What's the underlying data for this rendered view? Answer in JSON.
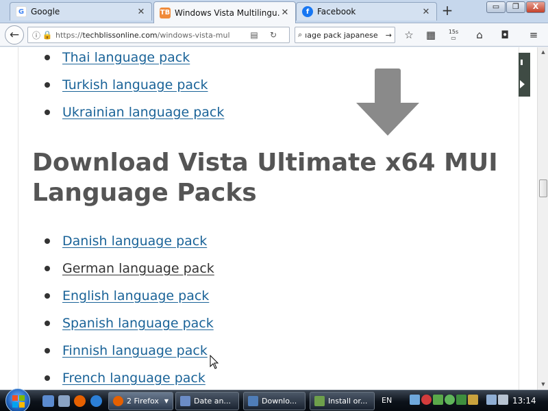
{
  "browser": {
    "tabs": [
      {
        "title": "Google",
        "favicon": "G",
        "favicon_color": "#4285f4",
        "active": false
      },
      {
        "title": "Windows Vista Multilingu…",
        "favicon": "TB",
        "favicon_color": "#f08b3a",
        "active": true
      },
      {
        "title": "Facebook",
        "favicon": "f",
        "favicon_color": "#1877f2",
        "active": false
      }
    ],
    "new_tab_label": "+",
    "tab_close": "✕",
    "window_controls": {
      "minimize": "▭",
      "maximize": "❐",
      "close": "X"
    },
    "url": {
      "prefix": "https://",
      "host": "techblissonline.com",
      "path": "/windows-vista-mul"
    },
    "search_value": "ıage pack japanese",
    "toolbar_badge": "15s"
  },
  "page": {
    "list_top": [
      {
        "label": "Thai language pack",
        "visited": false
      },
      {
        "label": "Turkish language pack",
        "visited": false
      },
      {
        "label": "Ukrainian language pack",
        "visited": false
      }
    ],
    "heading": "Download Vista Ultimate x64 MUI Language Packs",
    "list_bottom": [
      {
        "label": "Danish language pack",
        "visited": false
      },
      {
        "label": "German language pack",
        "visited": true
      },
      {
        "label": "English language pack",
        "visited": false
      },
      {
        "label": "Spanish language pack",
        "visited": false
      },
      {
        "label": "Finnish language pack",
        "visited": false
      },
      {
        "label": "French language pack",
        "visited": false
      }
    ],
    "link_color": "#1a6398",
    "visited_color": "#333333",
    "heading_color": "#555555"
  },
  "taskbar": {
    "tasks": [
      {
        "label": "2 Firefox",
        "icon_color": "#e66000",
        "active": true
      },
      {
        "label": "Date an...",
        "icon_color": "#6b8cc7",
        "active": false
      },
      {
        "label": "Downlo...",
        "icon_color": "#4f7db8",
        "active": false
      },
      {
        "label": "Install or...",
        "icon_color": "#6ea04b",
        "active": false
      }
    ],
    "language": "EN",
    "clock": "13:14"
  }
}
